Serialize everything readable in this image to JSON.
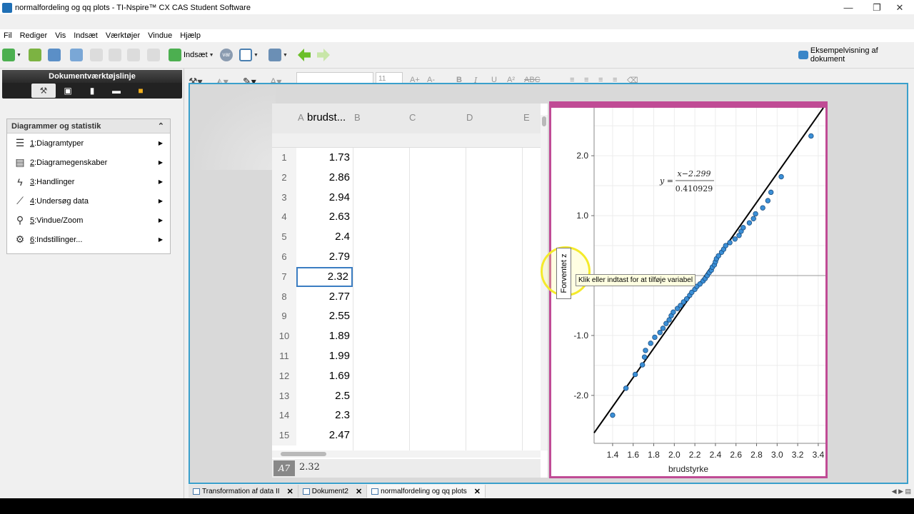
{
  "window": {
    "title": "normalfordeling og qq plots - TI-Nspire™ CX CAS Student Software",
    "controls": [
      "—",
      "❐",
      "✕"
    ]
  },
  "menubar": [
    "Fil",
    "Rediger",
    "Vis",
    "Indsæt",
    "Værktøjer",
    "Vindue",
    "Hjælp"
  ],
  "toolbar": {
    "insert_label": "Indsæt",
    "preview_label": "Eksempelvisning af dokument",
    "var_label": "var"
  },
  "doc_toolbar": {
    "title": "Dokumentværktøjslinje"
  },
  "tools_menu": {
    "header": "Diagrammer og statistik",
    "items": [
      {
        "num": "1",
        "label": ":Diagramtyper",
        "icon": "chart-types-icon"
      },
      {
        "num": "2",
        "label": ":Diagramegenskaber",
        "icon": "properties-icon"
      },
      {
        "num": "3",
        "label": ":Handlinger",
        "icon": "lightning-icon"
      },
      {
        "num": "4",
        "label": ":Undersøg data",
        "icon": "analyze-icon"
      },
      {
        "num": "5",
        "label": ":Vindue/Zoom",
        "icon": "magnifier-icon"
      },
      {
        "num": "6",
        "label": ":Indstillinger...",
        "icon": "gear-icon"
      }
    ]
  },
  "format": {
    "font_size": "11"
  },
  "spreadsheet": {
    "columns": [
      "A",
      "brudst...",
      "B",
      "C",
      "D",
      "E"
    ],
    "formula_marker": "=",
    "rows": [
      {
        "n": "1",
        "v": "1.73"
      },
      {
        "n": "2",
        "v": "2.86"
      },
      {
        "n": "3",
        "v": "2.94"
      },
      {
        "n": "4",
        "v": "2.63"
      },
      {
        "n": "5",
        "v": "2.4"
      },
      {
        "n": "6",
        "v": "2.79"
      },
      {
        "n": "7",
        "v": "2.32"
      },
      {
        "n": "8",
        "v": "2.77"
      },
      {
        "n": "9",
        "v": "2.55"
      },
      {
        "n": "10",
        "v": "1.89"
      },
      {
        "n": "11",
        "v": "1.99"
      },
      {
        "n": "12",
        "v": "1.69"
      },
      {
        "n": "13",
        "v": "2.5"
      },
      {
        "n": "14",
        "v": "2.3"
      },
      {
        "n": "15",
        "v": "2.47"
      }
    ],
    "selected_row": "7",
    "cell_ref": "A7",
    "entry_value": "2.32"
  },
  "chart_data": {
    "type": "scatter",
    "xlabel": "brudstyrke",
    "ylabel": "Forventet z",
    "xlim": [
      1.22,
      3.47
    ],
    "ylim": [
      -2.8,
      2.8
    ],
    "xticks": [
      "1.4",
      "1.6",
      "1.8",
      "2.0",
      "2.2",
      "2.4",
      "2.6",
      "2.8",
      "3.0",
      "3.2",
      "3.4"
    ],
    "yticks": [
      "2.0",
      "1.0",
      "-1.0",
      "-2.0"
    ],
    "regression": {
      "equation_lhs": "y =",
      "numerator": "x−2.299",
      "denominator": "0.410929"
    },
    "points": [
      [
        1.4,
        -2.33
      ],
      [
        1.53,
        -1.88
      ],
      [
        1.62,
        -1.65
      ],
      [
        1.69,
        -1.49
      ],
      [
        1.71,
        -1.36
      ],
      [
        1.72,
        -1.25
      ],
      [
        1.77,
        -1.13
      ],
      [
        1.81,
        -1.03
      ],
      [
        1.86,
        -0.95
      ],
      [
        1.89,
        -0.88
      ],
      [
        1.92,
        -0.8
      ],
      [
        1.95,
        -0.74
      ],
      [
        1.97,
        -0.67
      ],
      [
        1.99,
        -0.61
      ],
      [
        2.03,
        -0.55
      ],
      [
        2.06,
        -0.5
      ],
      [
        2.09,
        -0.44
      ],
      [
        2.12,
        -0.39
      ],
      [
        2.15,
        -0.33
      ],
      [
        2.17,
        -0.28
      ],
      [
        2.2,
        -0.23
      ],
      [
        2.22,
        -0.18
      ],
      [
        2.25,
        -0.14
      ],
      [
        2.28,
        -0.09
      ],
      [
        2.3,
        -0.05
      ],
      [
        2.32,
        0.0
      ],
      [
        2.34,
        0.05
      ],
      [
        2.36,
        0.09
      ],
      [
        2.37,
        0.14
      ],
      [
        2.39,
        0.18
      ],
      [
        2.4,
        0.23
      ],
      [
        2.41,
        0.28
      ],
      [
        2.43,
        0.33
      ],
      [
        2.46,
        0.39
      ],
      [
        2.48,
        0.44
      ],
      [
        2.5,
        0.5
      ],
      [
        2.54,
        0.55
      ],
      [
        2.59,
        0.61
      ],
      [
        2.63,
        0.67
      ],
      [
        2.65,
        0.74
      ],
      [
        2.67,
        0.8
      ],
      [
        2.73,
        0.88
      ],
      [
        2.77,
        0.95
      ],
      [
        2.79,
        1.03
      ],
      [
        2.86,
        1.13
      ],
      [
        2.91,
        1.25
      ],
      [
        2.94,
        1.39
      ],
      [
        3.04,
        1.65
      ],
      [
        3.33,
        2.33
      ]
    ],
    "line": {
      "intercept_x": 2.299,
      "slope_sd": 0.410929
    },
    "grid": true
  },
  "tooltip": "Klik eller indtast for at tilføje variabel",
  "doc_tabs": [
    {
      "label": "Transformation af data II",
      "active": false
    },
    {
      "label": "Dokument2",
      "active": false
    },
    {
      "label": "normalfordeling og qq plots",
      "active": true
    }
  ],
  "colors": {
    "accent_blue": "#3aa0cc",
    "graph_border": "#c04b95",
    "point_fill": "#3b8fd6",
    "tooltip_bg": "#ffffe1",
    "highlight_ring": "#f4ea2a"
  }
}
